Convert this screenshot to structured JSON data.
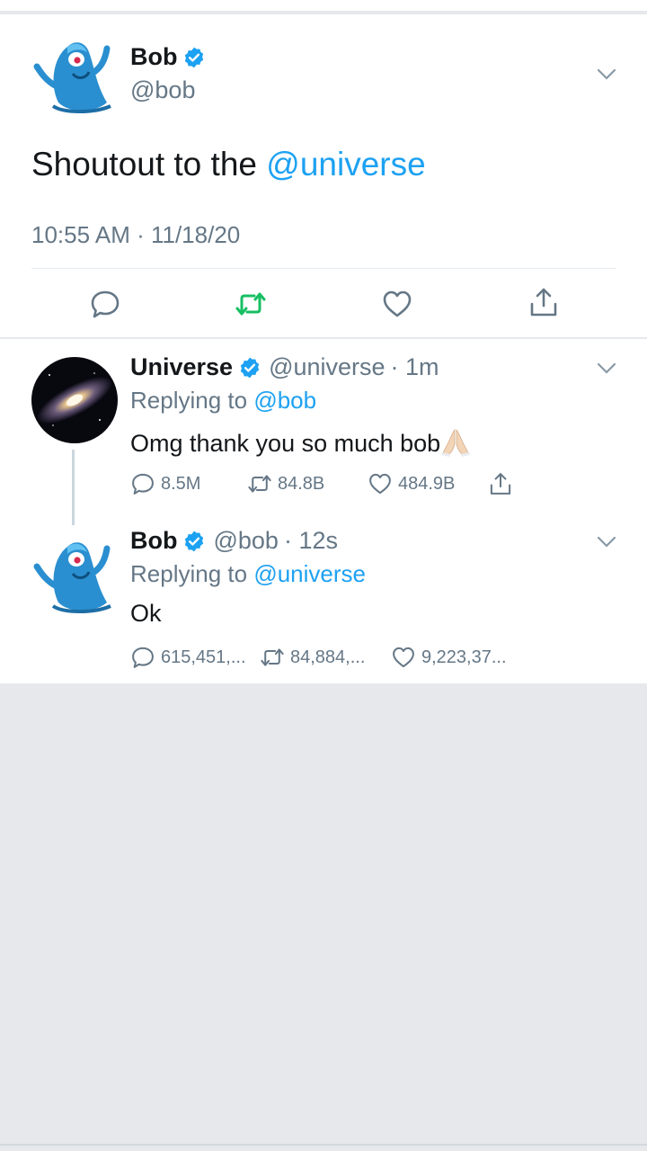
{
  "main_tweet": {
    "name": "Bob",
    "handle": "@bob",
    "text_prefix": "Shoutout to the ",
    "text_mention": "@universe",
    "timestamp": "10:55 AM · 11/18/20"
  },
  "replies": [
    {
      "name": "Universe",
      "handle": "@universe",
      "age": "· 1m",
      "replying_label": "Replying to",
      "replying_to": "@bob",
      "text": "Omg thank you so much bob",
      "replies_count": "8.5M",
      "retweets_count": "84.8B",
      "likes_count": "484.9B"
    },
    {
      "name": "Bob",
      "handle": "@bob",
      "age": "· 12s",
      "replying_label": "Replying to",
      "replying_to": "@universe",
      "text": "Ok",
      "replies_count": "615,451,...",
      "retweets_count": "84,884,...",
      "likes_count": "9,223,37..."
    }
  ],
  "colors": {
    "accent": "#1da1f2",
    "retweet_active": "#17bf63",
    "muted": "#657786"
  },
  "icons": [
    "verified-badge-icon",
    "chevron-down-icon",
    "reply-icon",
    "retweet-icon",
    "like-icon",
    "share-icon",
    "folded-hands-emoji"
  ]
}
